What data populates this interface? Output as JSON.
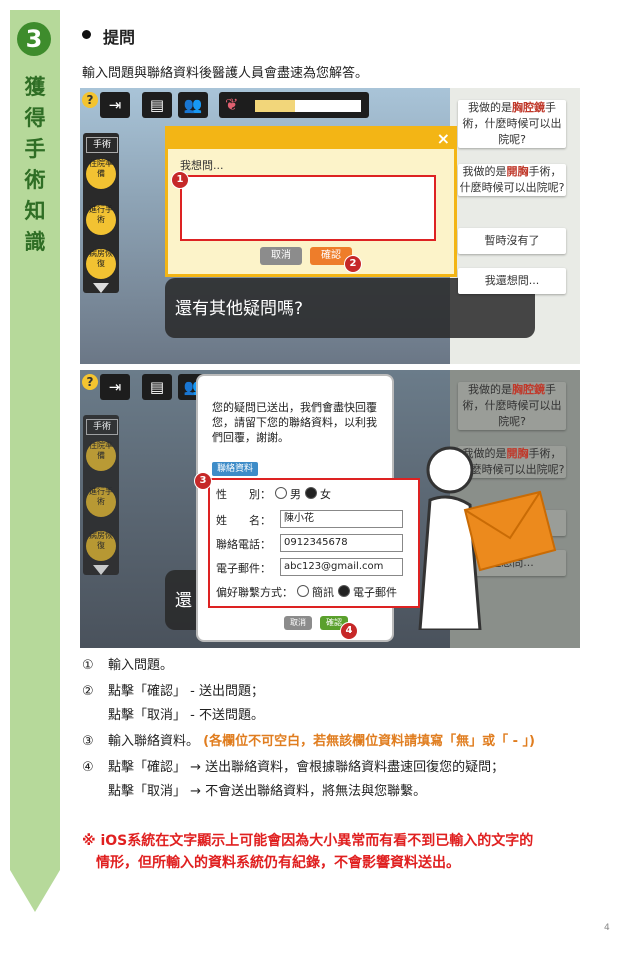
{
  "step_number": "3",
  "vertical_title": "獲得手術知識",
  "heading": "提問",
  "intro": "輸入問題與聯絡資料後醫護人員會盡速為您解答。",
  "app": {
    "qmark": "?",
    "lung_label": "肺活量",
    "lung_level": 0.38,
    "side_title": "手術",
    "side_steps": [
      "住院準備",
      "進行手術",
      "病房恢復"
    ],
    "right_buttons": [
      {
        "pre": "我做的是",
        "em": "胸腔鏡",
        "post": "手術，什麼時候可以出院呢?"
      },
      {
        "pre": "我做的是",
        "em": "開胸",
        "post": "手術，什麼時候可以出院呢?"
      },
      {
        "pre": "暫時沒有了",
        "em": "",
        "post": ""
      },
      {
        "pre": "我還想問...",
        "em": "",
        "post": ""
      }
    ],
    "speech_text": "還有其他疑問嗎?",
    "speech_text_partial": "還"
  },
  "dialog1": {
    "label": "我想問...",
    "cancel": "取消",
    "confirm": "確認",
    "close": "×",
    "badges": [
      "1",
      "2"
    ]
  },
  "dialog2": {
    "message": "您的疑問已送出，我們會盡快回覆您，請留下您的聯絡資料，以利我們回覆，謝謝。",
    "tag": "聯絡資料",
    "gender_label": "性　　別：",
    "male": "男",
    "female": "女",
    "name_label": "姓　　名：",
    "name_value": "陳小花",
    "phone_label": "聯絡電話：",
    "phone_value": "0912345678",
    "email_label": "電子郵件：",
    "email_value": "abc123@gmail.com",
    "contact_label": "偏好聯繫方式：",
    "sms": "簡訊",
    "email_opt": "電子郵件",
    "cancel": "取消",
    "confirm": "確認",
    "badges": [
      "3",
      "4"
    ],
    "right_partial_4": "還想問..."
  },
  "notes": [
    {
      "num": "①",
      "text": "輸入問題。"
    },
    {
      "num": "②",
      "text": "點擊「確認」 - 送出問題；"
    },
    {
      "num": "",
      "text": "點擊「取消」 - 不送問題。"
    },
    {
      "num": "③",
      "text": "輸入聯絡資料。",
      "extra": "(各欄位不可空白，若無該欄位資料請填寫「無」或「 - 」)"
    },
    {
      "num": "④",
      "text": "點擊「確認」 → 送出聯絡資料，會根據聯絡資料盡速回復您的疑問；"
    },
    {
      "num": "",
      "text": "點擊「取消」 → 不會送出聯絡資料，將無法與您聯繫。"
    }
  ],
  "warning_line1": "※ iOS系統在文字顯示上可能會因為大小異常而有看不到已輸入的文字的",
  "warning_line2": "情形，但所輸入的資料系統仍有紀錄，不會影響資料送出。",
  "page_number": "4",
  "colors": {
    "ribbon": "#b6d99a",
    "step": "#3e8c2c",
    "highlight": "#d22",
    "dialog_border": "#f3b515",
    "warning": "#e02020",
    "orange_note": "#e07d1f"
  }
}
